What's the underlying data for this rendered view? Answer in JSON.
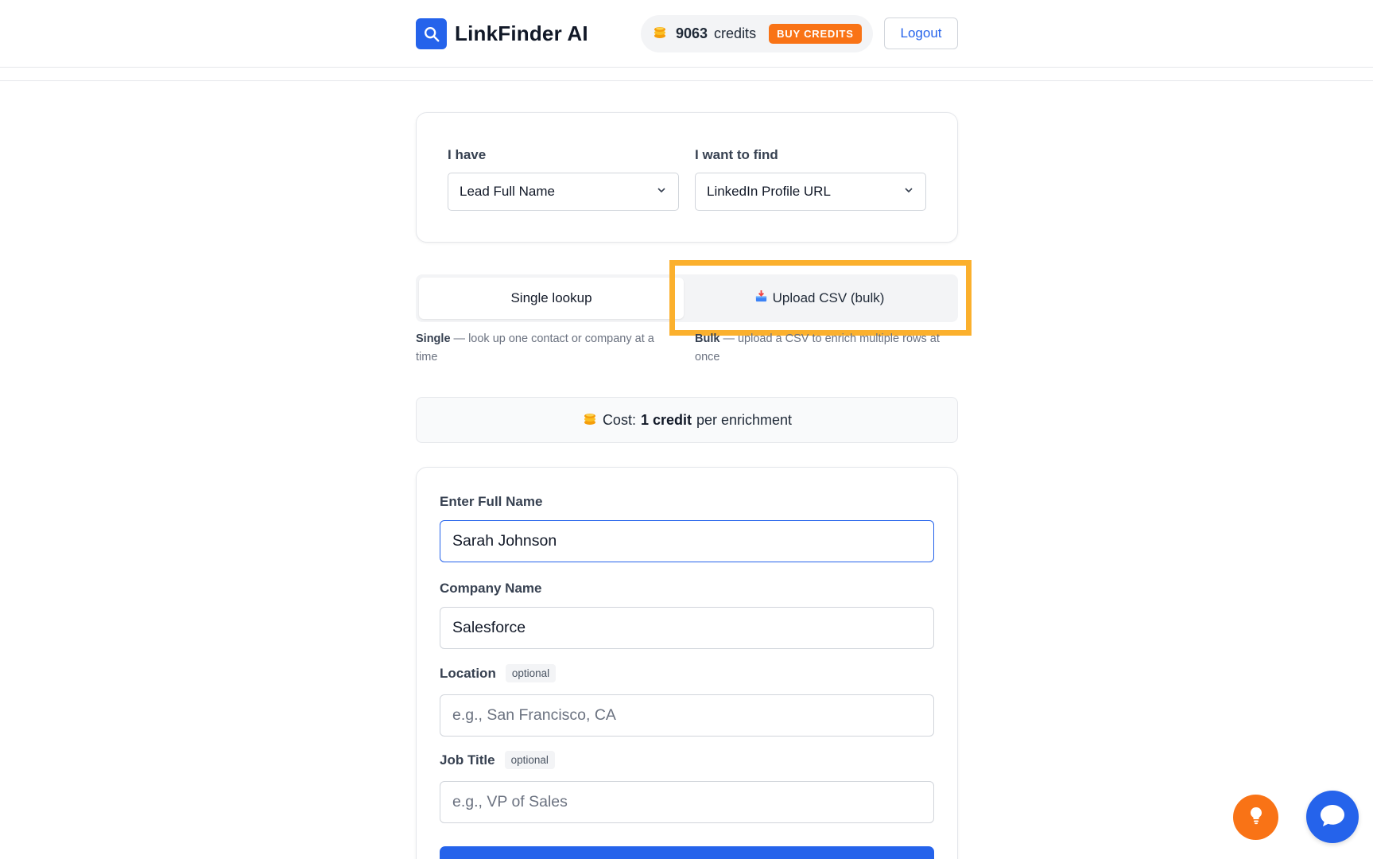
{
  "header": {
    "brand_name": "LinkFinder AI",
    "credits_count": "9063",
    "credits_label": "credits",
    "buy_credits_label": "BUY CREDITS",
    "logout_label": "Logout"
  },
  "lookup_config": {
    "have_label": "I have",
    "have_value": "Lead Full Name",
    "find_label": "I want to find",
    "find_value": "LinkedIn Profile URL"
  },
  "mode": {
    "single_label": "Single lookup",
    "bulk_label": "Upload CSV (bulk)",
    "single_desc_bold": "Single",
    "single_desc": " — look up one contact or company at a time",
    "bulk_desc_bold": "Bulk",
    "bulk_desc": " — upload a CSV to enrich multiple rows at once"
  },
  "cost": {
    "prefix": "Cost:",
    "amount": "1 credit",
    "suffix": "per enrichment"
  },
  "form": {
    "full_name_label": "Enter Full Name",
    "full_name_value": "Sarah Johnson",
    "company_label": "Company Name",
    "company_value": "Salesforce",
    "location_label": "Location",
    "location_badge": "optional",
    "location_placeholder": "e.g., San Francisco, CA",
    "job_title_label": "Job Title",
    "job_title_badge": "optional",
    "job_title_placeholder": "e.g., VP of Sales"
  },
  "colors": {
    "accent": "#2563eb",
    "orange": "#f97316",
    "highlight": "#fbb02d"
  },
  "icons": {
    "brand": "search-icon",
    "coins": "coins-icon",
    "upload": "inbox-tray-icon",
    "tip": "lightbulb-icon",
    "chat": "chat-bubble-icon"
  }
}
